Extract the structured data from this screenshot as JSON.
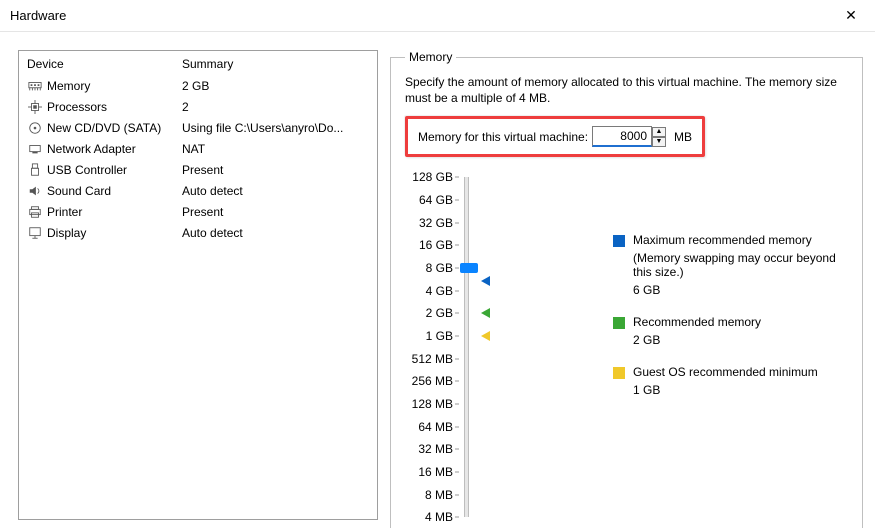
{
  "titlebar": {
    "title": "Hardware"
  },
  "hw_header": {
    "device": "Device",
    "summary": "Summary"
  },
  "hw_rows": [
    {
      "icon": "ram",
      "device": "Memory",
      "summary": "2 GB"
    },
    {
      "icon": "cpu",
      "device": "Processors",
      "summary": "2"
    },
    {
      "icon": "disc",
      "device": "New CD/DVD (SATA)",
      "summary": "Using file C:\\Users\\anyro\\Do..."
    },
    {
      "icon": "nic",
      "device": "Network Adapter",
      "summary": "NAT"
    },
    {
      "icon": "usb",
      "device": "USB Controller",
      "summary": "Present"
    },
    {
      "icon": "sound",
      "device": "Sound Card",
      "summary": "Auto detect"
    },
    {
      "icon": "printer",
      "device": "Printer",
      "summary": "Present"
    },
    {
      "icon": "display",
      "device": "Display",
      "summary": "Auto detect"
    }
  ],
  "memory": {
    "legend_title": "Memory",
    "description": "Specify the amount of memory allocated to this virtual machine. The memory size must be a multiple of 4 MB.",
    "input_label": "Memory for this virtual machine:",
    "value": "8000",
    "unit": "MB"
  },
  "ticks": [
    "128 GB",
    "64 GB",
    "32 GB",
    "16 GB",
    "8 GB",
    "4 GB",
    "2 GB",
    "1 GB",
    "512 MB",
    "256 MB",
    "128 MB",
    "64 MB",
    "32 MB",
    "16 MB",
    "8 MB",
    "4 MB"
  ],
  "legend": {
    "max_label": "Maximum recommended memory",
    "max_note": "(Memory swapping may occur beyond this size.)",
    "max_value": "6 GB",
    "rec_label": "Recommended memory",
    "rec_value": "2 GB",
    "min_label": "Guest OS recommended minimum",
    "min_value": "1 GB"
  },
  "slider_positions": {
    "thumb_pct": 26.7,
    "marker_max_pct": 30.5,
    "marker_rec_pct": 40.0,
    "marker_min_pct": 46.7
  }
}
